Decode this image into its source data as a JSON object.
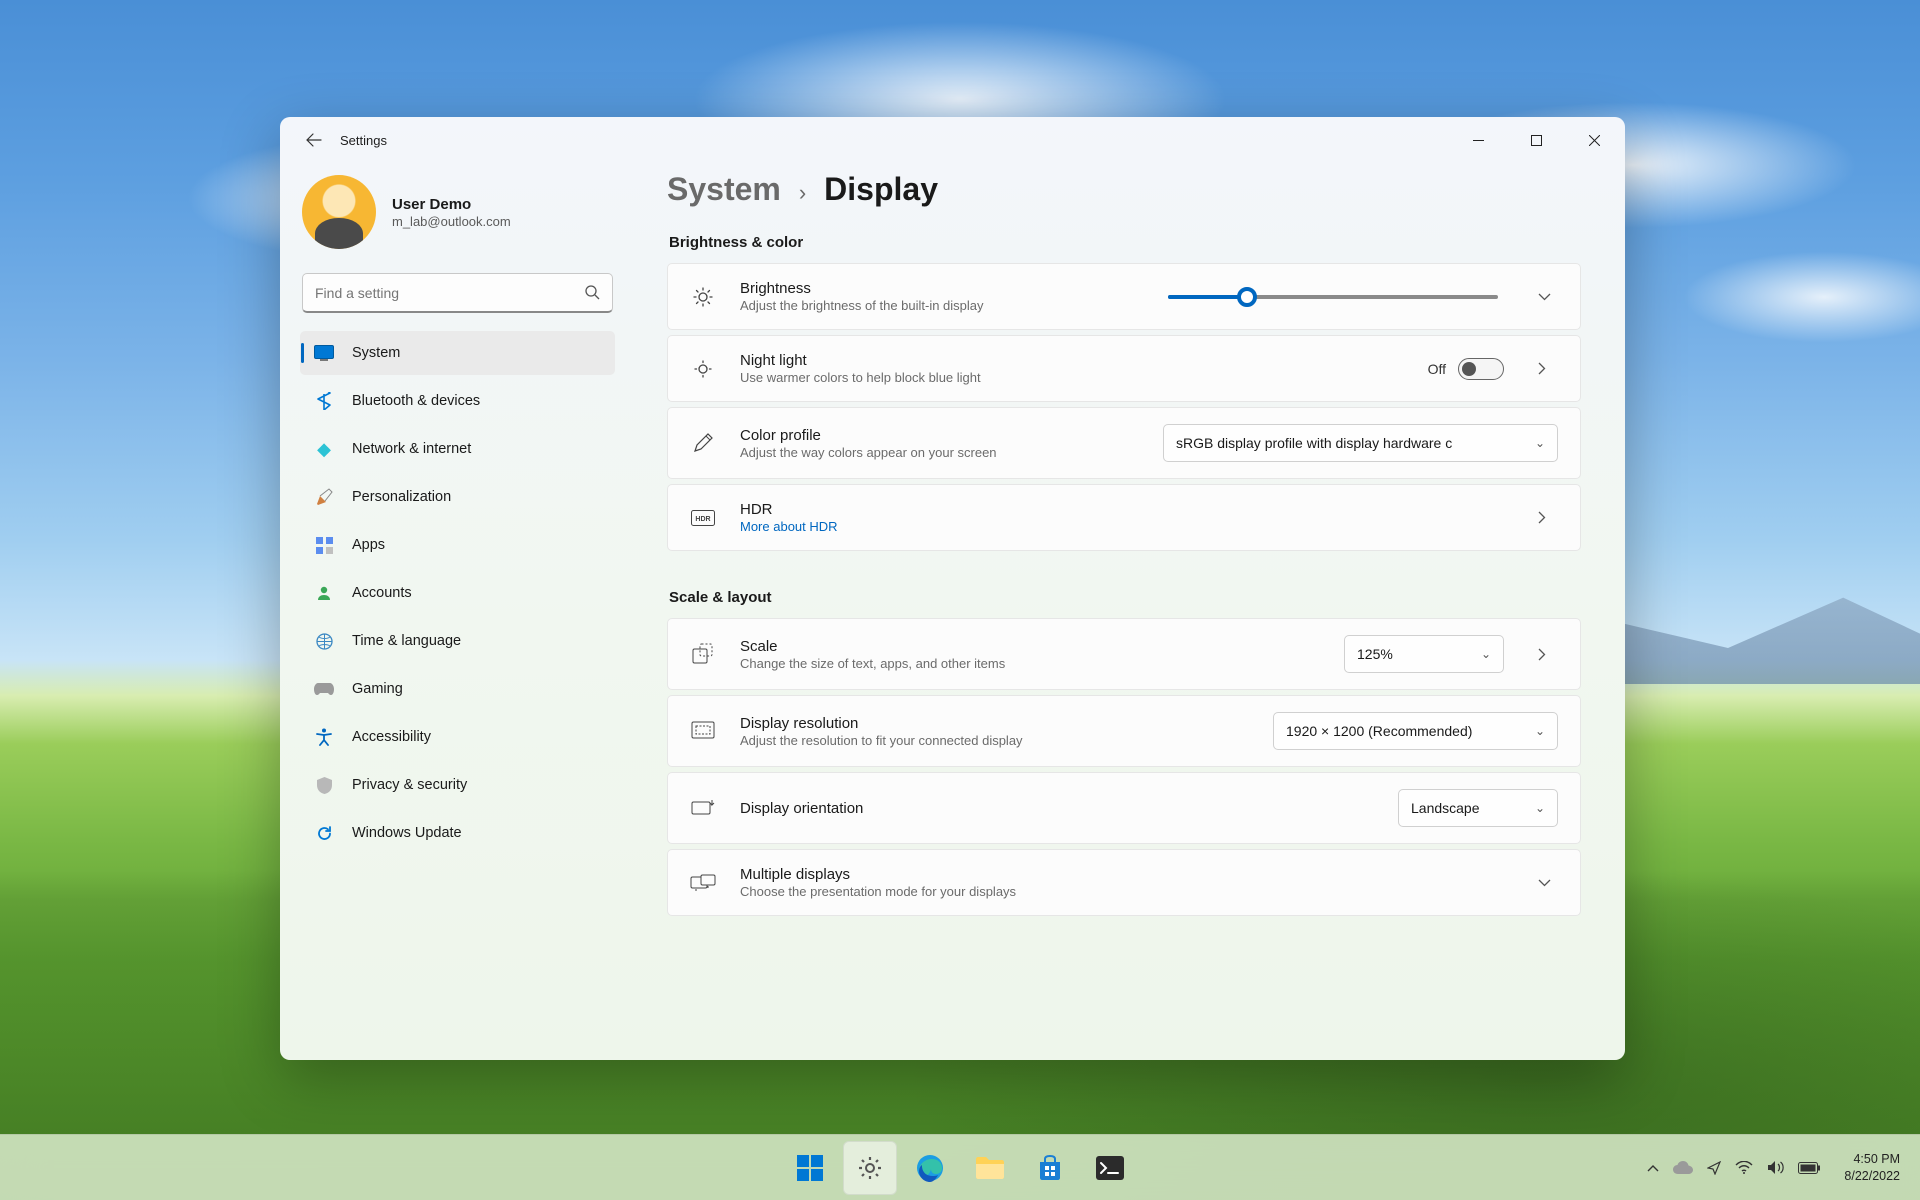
{
  "window": {
    "title": "Settings",
    "profile_name": "User Demo",
    "profile_email": "m_lab@outlook.com",
    "search_placeholder": "Find a setting"
  },
  "sidebar": {
    "items": [
      {
        "label": "System",
        "icon": "🖥️",
        "color": "#0078d4"
      },
      {
        "label": "Bluetooth & devices",
        "icon": "bt"
      },
      {
        "label": "Network & internet",
        "icon": "🛜"
      },
      {
        "label": "Personalization",
        "icon": "🖌️"
      },
      {
        "label": "Apps",
        "icon": "▦"
      },
      {
        "label": "Accounts",
        "icon": "👤"
      },
      {
        "label": "Time & language",
        "icon": "🌐"
      },
      {
        "label": "Gaming",
        "icon": "🎮"
      },
      {
        "label": "Accessibility",
        "icon": "acc"
      },
      {
        "label": "Privacy & security",
        "icon": "🛡️"
      },
      {
        "label": "Windows Update",
        "icon": "🔄"
      }
    ]
  },
  "breadcrumb": {
    "parent": "System",
    "current": "Display"
  },
  "sections": {
    "brightness": {
      "heading": "Brightness & color",
      "items": {
        "brightness": {
          "title": "Brightness",
          "sub": "Adjust the brightness of the built-in display",
          "value_percent": 24
        },
        "night_light": {
          "title": "Night light",
          "sub": "Use warmer colors to help block blue light",
          "toggle_state": "Off"
        },
        "color_profile": {
          "title": "Color profile",
          "sub": "Adjust the way colors appear on your screen",
          "dropdown_value": "sRGB display profile with display hardware c"
        },
        "hdr": {
          "title": "HDR",
          "link": "More about HDR"
        }
      }
    },
    "scale": {
      "heading": "Scale & layout",
      "items": {
        "scale": {
          "title": "Scale",
          "sub": "Change the size of text, apps, and other items",
          "dropdown_value": "125%"
        },
        "resolution": {
          "title": "Display resolution",
          "sub": "Adjust the resolution to fit your connected display",
          "dropdown_value": "1920 × 1200 (Recommended)"
        },
        "orientation": {
          "title": "Display orientation",
          "dropdown_value": "Landscape"
        },
        "multiple": {
          "title": "Multiple displays",
          "sub": "Choose the presentation mode for your displays"
        }
      }
    }
  },
  "taskbar": {
    "apps": [
      "start",
      "settings",
      "edge",
      "explorer",
      "store",
      "terminal"
    ],
    "clock_time": "4:50 PM",
    "clock_date": "8/22/2022"
  }
}
